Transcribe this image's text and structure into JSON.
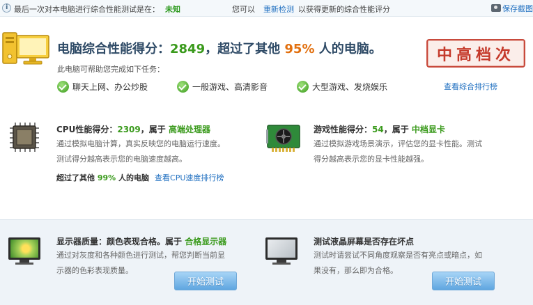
{
  "topbar": {
    "last_test_label": "最后一次对本电脑进行综合性能测试是在：",
    "last_test_value": "未知",
    "prompt_prefix": "您可以",
    "recheck_link": "重新检测",
    "prompt_suffix": "以获得更新的综合性能评分",
    "save_link": "保存截图"
  },
  "summary": {
    "title_prefix": "电脑综合性能得分：",
    "score": "2849",
    "title_mid": "，超过了其他",
    "percent": "95%",
    "title_suffix": "人的电脑。",
    "subtitle": "此电脑可帮助您完成如下任务：",
    "stamp": "中高档次",
    "tasks": [
      "聊天上网、办公炒股",
      "一般游戏、高清影音",
      "大型游戏、发烧娱乐"
    ],
    "rank_link": "查看综合排行榜"
  },
  "cpu": {
    "label": "CPU性能得分：",
    "score": "2309",
    "belongs": "，属于",
    "level": "高端处理器",
    "desc1": "通过模拟电脑计算，真实反映您的电脑运行速度。",
    "desc2": "测试得分越高表示您的电脑速度越高。",
    "beat_prefix": "超过了其他",
    "beat_percent": "99%",
    "beat_suffix": "人的电脑",
    "rank_link": "查看CPU速度排行榜"
  },
  "gpu": {
    "label": "游戏性能得分：",
    "score": "54",
    "belongs": "，属于",
    "level": "中档显卡",
    "desc1": "通过模拟游戏场景演示，评估您的显卡性能。测试",
    "desc2": "得分越高表示您的显卡性能越强。"
  },
  "display": {
    "title_prefix": "显示器质量：颜色表现合格。属于",
    "level": "合格显示器",
    "desc1": "通过对灰度和各种颜色进行测试，帮您判断当前显",
    "desc2": "示器的色彩表现质量。",
    "button": "开始测试"
  },
  "lcd": {
    "title": "测试液晶屏幕是否存在坏点",
    "desc1": "测试时请尝试不同角度观察是否有亮点或暗点，如",
    "desc2": "果没有，那么即为合格。",
    "button": "开始测试"
  },
  "colors": {
    "green": "#3a9a1c",
    "orange": "#e2700f",
    "link": "#1f6fc0",
    "title": "#2e4a66",
    "stamp": "#c53a2b"
  },
  "icons": [
    "info-icon",
    "camera-icon",
    "pc-icon",
    "check-icon",
    "cpu-icon",
    "gpu-icon",
    "monitor-icon"
  ]
}
